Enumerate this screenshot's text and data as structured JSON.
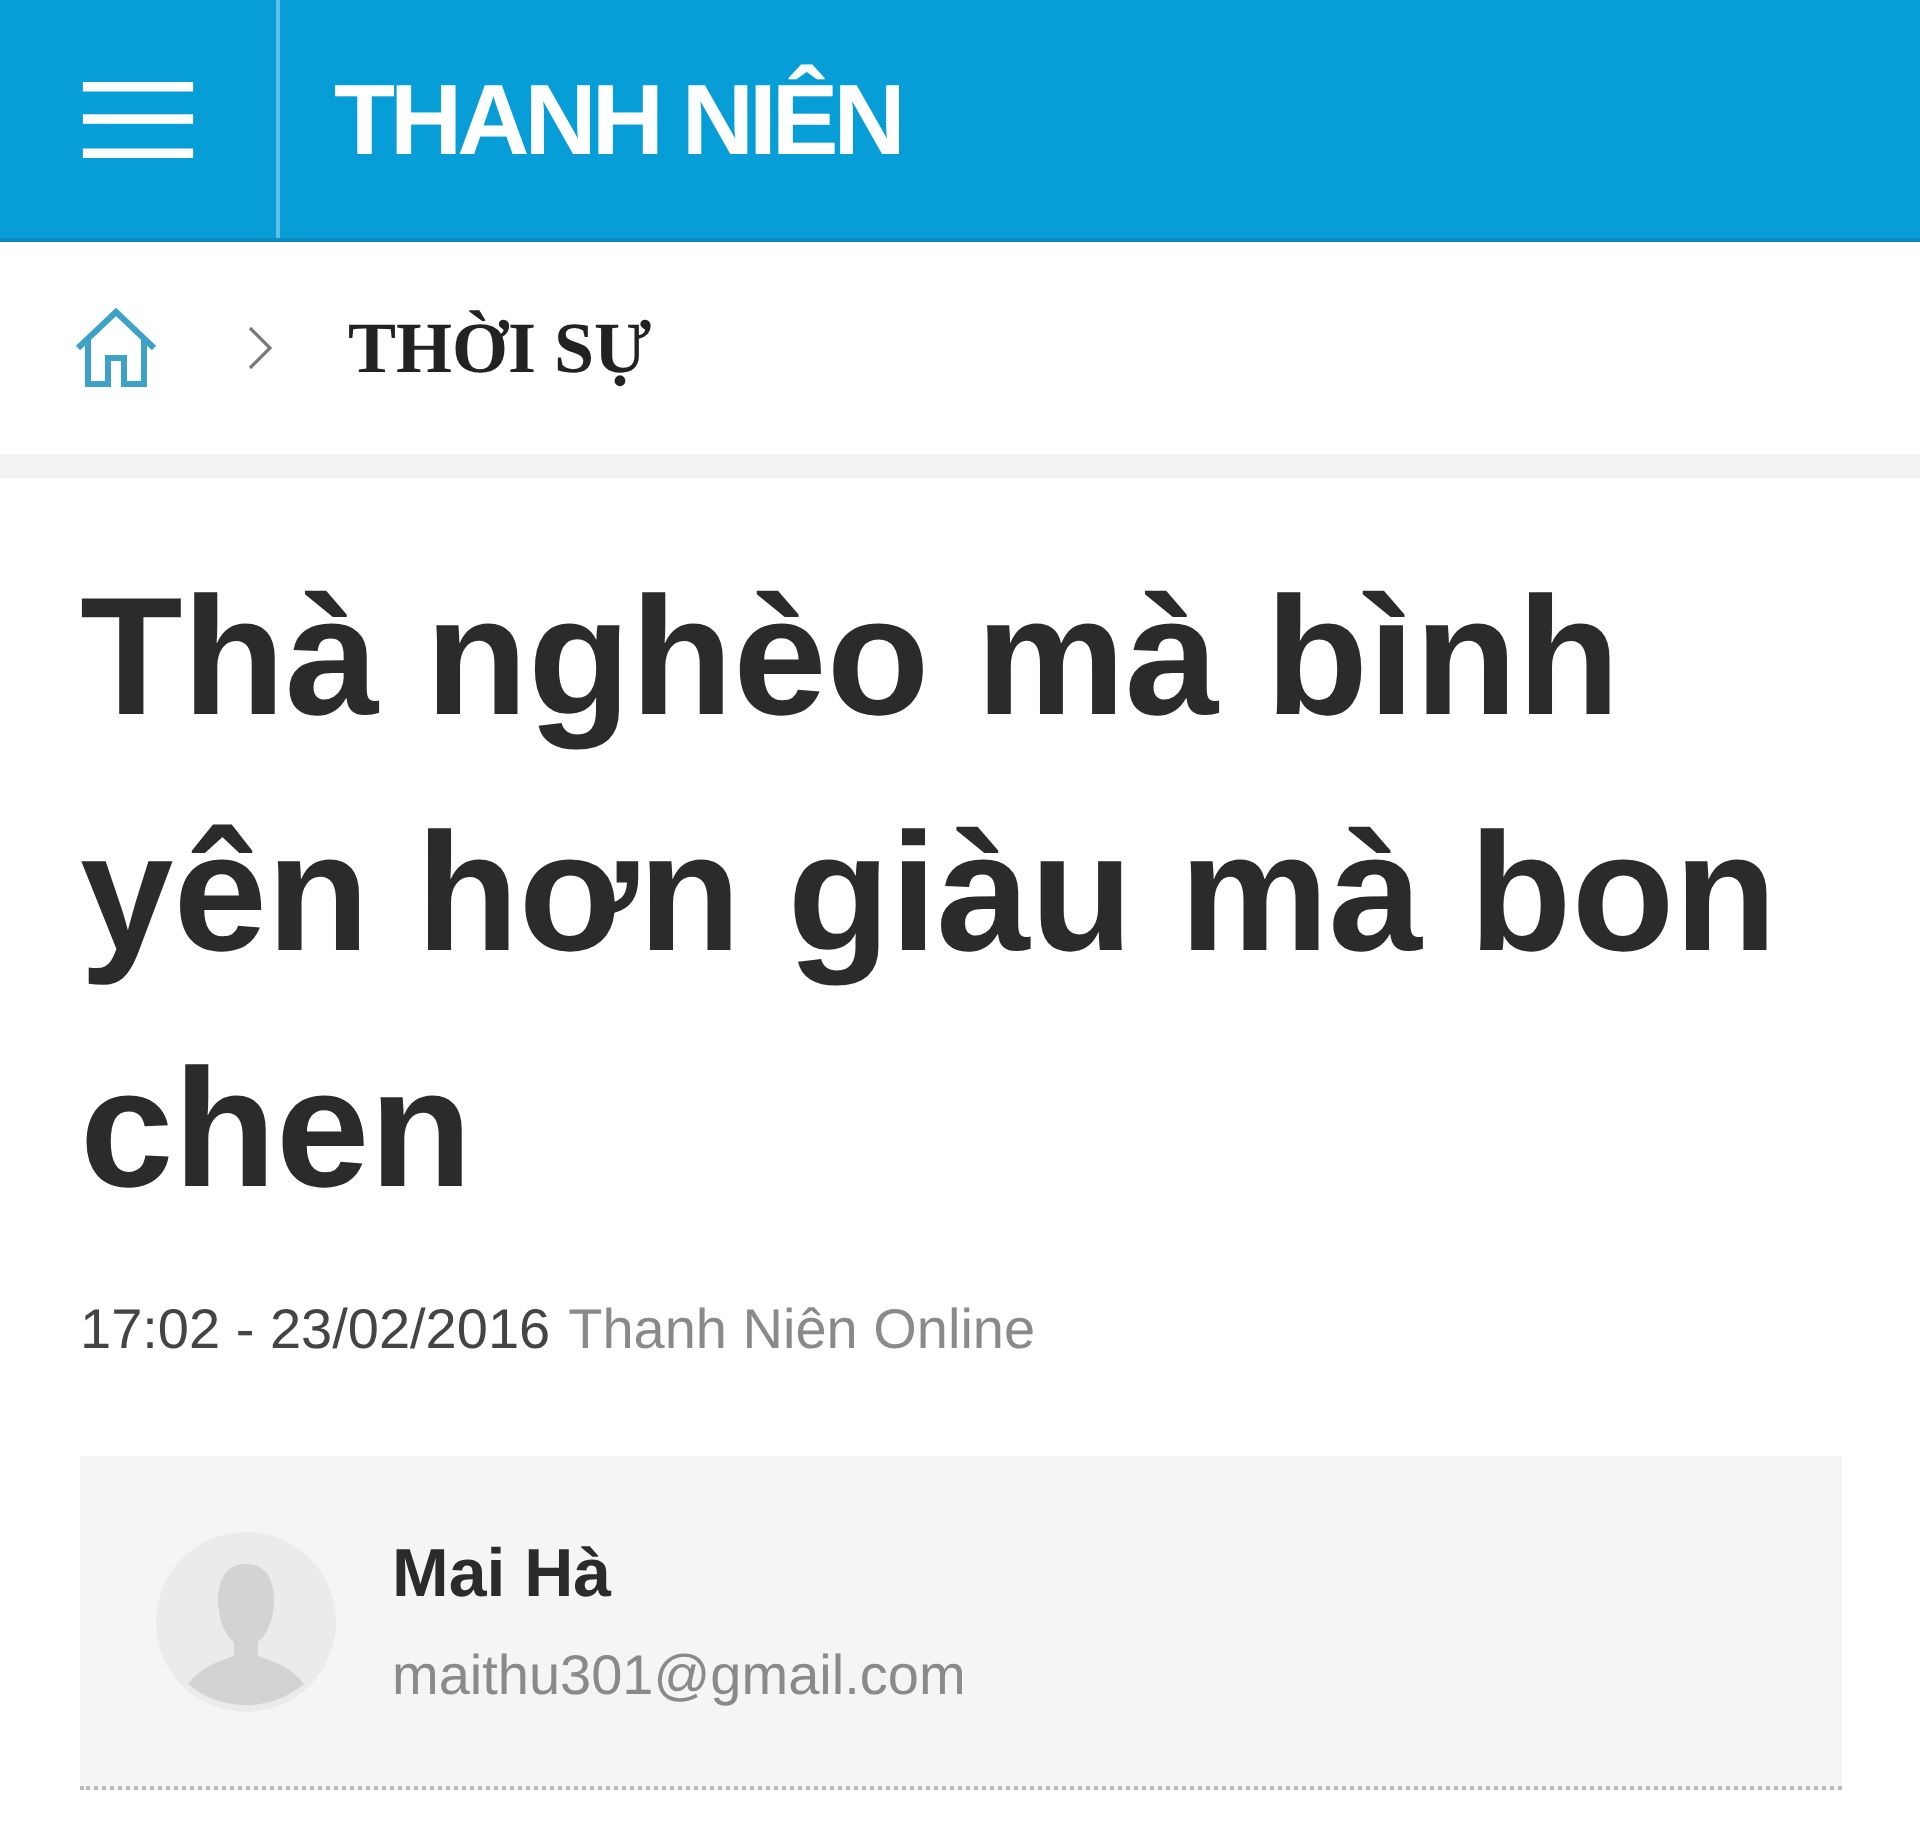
{
  "header": {
    "logo": "THANH NIÊN"
  },
  "breadcrumb": {
    "section": "THỜI SỰ"
  },
  "article": {
    "title": "Thà nghèo mà bình yên hơn giàu mà bon chen",
    "date": "17:02 - 23/02/2016",
    "source": "Thanh Niên Online"
  },
  "author": {
    "name": "Mai Hà",
    "email": "maithu301@gmail.com"
  }
}
